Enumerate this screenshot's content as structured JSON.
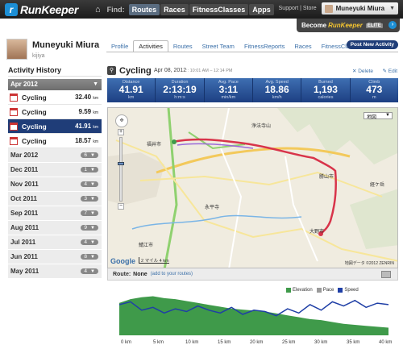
{
  "app": {
    "logo_letter": "r",
    "logo_text": "RunKeeper"
  },
  "topnav": {
    "find_label": "Find:",
    "items": [
      {
        "label": "Routes",
        "active": true
      },
      {
        "label": "Races",
        "active": false
      },
      {
        "label": "FitnessClasses",
        "active": false
      },
      {
        "label": "Apps",
        "active": false
      }
    ],
    "support_store": "Support | Store",
    "user_name": "Muneyuki Miura"
  },
  "elite": {
    "become": "Become",
    "brand": "RunKeeper",
    "tag": "ELITE"
  },
  "profile": {
    "name": "Muneyuki Miura",
    "sub": "kijiya"
  },
  "profile_tabs": [
    {
      "label": "Profile",
      "active": false
    },
    {
      "label": "Activities",
      "active": true
    },
    {
      "label": "Routes",
      "active": false
    },
    {
      "label": "Street Team",
      "active": false
    },
    {
      "label": "FitnessReports",
      "active": false
    },
    {
      "label": "Races",
      "active": false
    },
    {
      "label": "FitnessClasses",
      "active": false
    }
  ],
  "post_button": "Post New Activity",
  "history": {
    "title": "Activity History",
    "current_month": "Apr 2012",
    "activities": [
      {
        "name": "Cycling",
        "dist": "32.40",
        "unit": "km",
        "selected": false
      },
      {
        "name": "Cycling",
        "dist": "9.59",
        "unit": "km",
        "selected": false
      },
      {
        "name": "Cycling",
        "dist": "41.91",
        "unit": "km",
        "selected": true
      },
      {
        "name": "Cycling",
        "dist": "18.57",
        "unit": "km",
        "selected": false
      }
    ],
    "months": [
      {
        "name": "Mar 2012",
        "count": "6"
      },
      {
        "name": "Dec 2011",
        "count": "1"
      },
      {
        "name": "Nov 2011",
        "count": "4"
      },
      {
        "name": "Oct 2011",
        "count": "3"
      },
      {
        "name": "Sep 2011",
        "count": "7"
      },
      {
        "name": "Aug 2011",
        "count": "9"
      },
      {
        "name": "Jul 2011",
        "count": "4"
      },
      {
        "name": "Jun 2011",
        "count": "8"
      },
      {
        "name": "May 2011",
        "count": "4"
      }
    ]
  },
  "activity": {
    "title": "Cycling",
    "date": "Apr 08, 2012",
    "time": "::  10:01 AM – 12:14 PM",
    "delete_label": "Delete",
    "edit_label": "Edit"
  },
  "stats": [
    {
      "label": "Distance",
      "value": "41.91",
      "unit": "km"
    },
    {
      "label": "Duration",
      "value": "2:13:19",
      "unit": "h:m:s"
    },
    {
      "label": "Avg. Pace",
      "value": "3:11",
      "unit": "min/km"
    },
    {
      "label": "Avg. Speed",
      "value": "18.86",
      "unit": "km/h"
    },
    {
      "label": "Burned",
      "value": "1,193",
      "unit": "calories"
    },
    {
      "label": "Climb",
      "value": "473",
      "unit": "m"
    }
  ],
  "map": {
    "type_select": "地図",
    "google": "Google",
    "scale_mi": "2 マイル",
    "scale_km": "4 km",
    "credit": "地図データ ©2012 ZENRIN",
    "labels": [
      {
        "text": "福井市"
      },
      {
        "text": "勝山市"
      },
      {
        "text": "大野市"
      },
      {
        "text": "鯖江市"
      },
      {
        "text": "浄法寺山"
      },
      {
        "text": "経ケ岳"
      },
      {
        "text": "永平寺"
      }
    ]
  },
  "route": {
    "label": "Route:",
    "value": "None",
    "add": "(add to your routes)"
  },
  "chart_data": {
    "type": "area",
    "series": [
      {
        "name": "Elevation",
        "color": "#3f9a4a",
        "values": [
          170,
          190,
          200,
          205,
          195,
          190,
          180,
          170,
          160,
          150,
          140,
          135,
          130,
          125,
          115,
          105,
          95,
          85,
          80,
          70,
          60,
          55,
          50,
          45,
          40
        ]
      },
      {
        "name": "Pace",
        "color": "#9a9a9a",
        "values": []
      },
      {
        "name": "Speed",
        "color": "#1f3fa6",
        "values": [
          22,
          24,
          18,
          20,
          16,
          19,
          17,
          21,
          18,
          16,
          20,
          15,
          18,
          17,
          14,
          19,
          16,
          22,
          18,
          24,
          21,
          25,
          20,
          23,
          22
        ]
      }
    ],
    "x_ticks": [
      "0 km",
      "5 km",
      "10 km",
      "15 km",
      "20 km",
      "25 km",
      "30 km",
      "35 km",
      "40 km"
    ],
    "xlim": [
      0,
      42
    ]
  }
}
